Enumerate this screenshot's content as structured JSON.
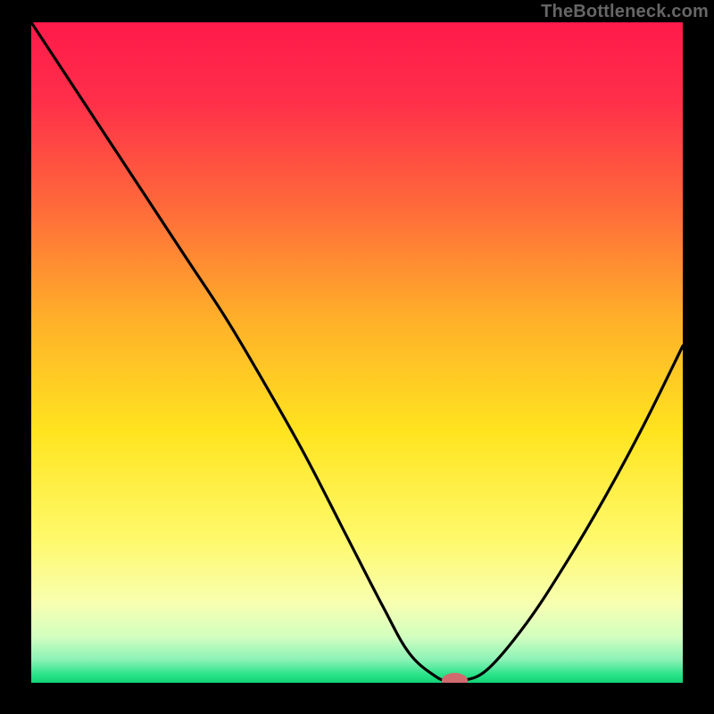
{
  "watermark": "TheBottleneck.com",
  "chart_data": {
    "type": "line",
    "title": "",
    "xlabel": "",
    "ylabel": "",
    "xlim": [
      0,
      100
    ],
    "ylim": [
      0,
      100
    ],
    "grid": false,
    "series": [
      {
        "name": "curve",
        "x_values": [
          0,
          6,
          12,
          18,
          24,
          30,
          36,
          42,
          48,
          54,
          58,
          62,
          64,
          66,
          70,
          76,
          82,
          88,
          94,
          100
        ],
        "y_values": [
          100,
          91,
          82,
          73,
          64,
          55,
          45,
          34.5,
          23,
          11.5,
          4.5,
          1.0,
          0.3,
          0.3,
          2.0,
          9.0,
          18,
          28,
          39,
          51
        ],
        "color": "#000000"
      }
    ],
    "background_gradient": {
      "type": "vertical",
      "stops": [
        {
          "offset": 0.0,
          "color": "#ff1a4b"
        },
        {
          "offset": 0.12,
          "color": "#ff2f4a"
        },
        {
          "offset": 0.28,
          "color": "#ff6a3a"
        },
        {
          "offset": 0.45,
          "color": "#ffb029"
        },
        {
          "offset": 0.62,
          "color": "#ffe41f"
        },
        {
          "offset": 0.78,
          "color": "#fff96a"
        },
        {
          "offset": 0.88,
          "color": "#f7ffb0"
        },
        {
          "offset": 0.93,
          "color": "#d3ffc0"
        },
        {
          "offset": 0.965,
          "color": "#8cf2b7"
        },
        {
          "offset": 0.988,
          "color": "#29e389"
        },
        {
          "offset": 1.0,
          "color": "#12d477"
        }
      ]
    },
    "marker": {
      "x": 65,
      "y": 0.3,
      "rx": 2.0,
      "ry": 1.2,
      "color": "#d06a6f"
    }
  }
}
